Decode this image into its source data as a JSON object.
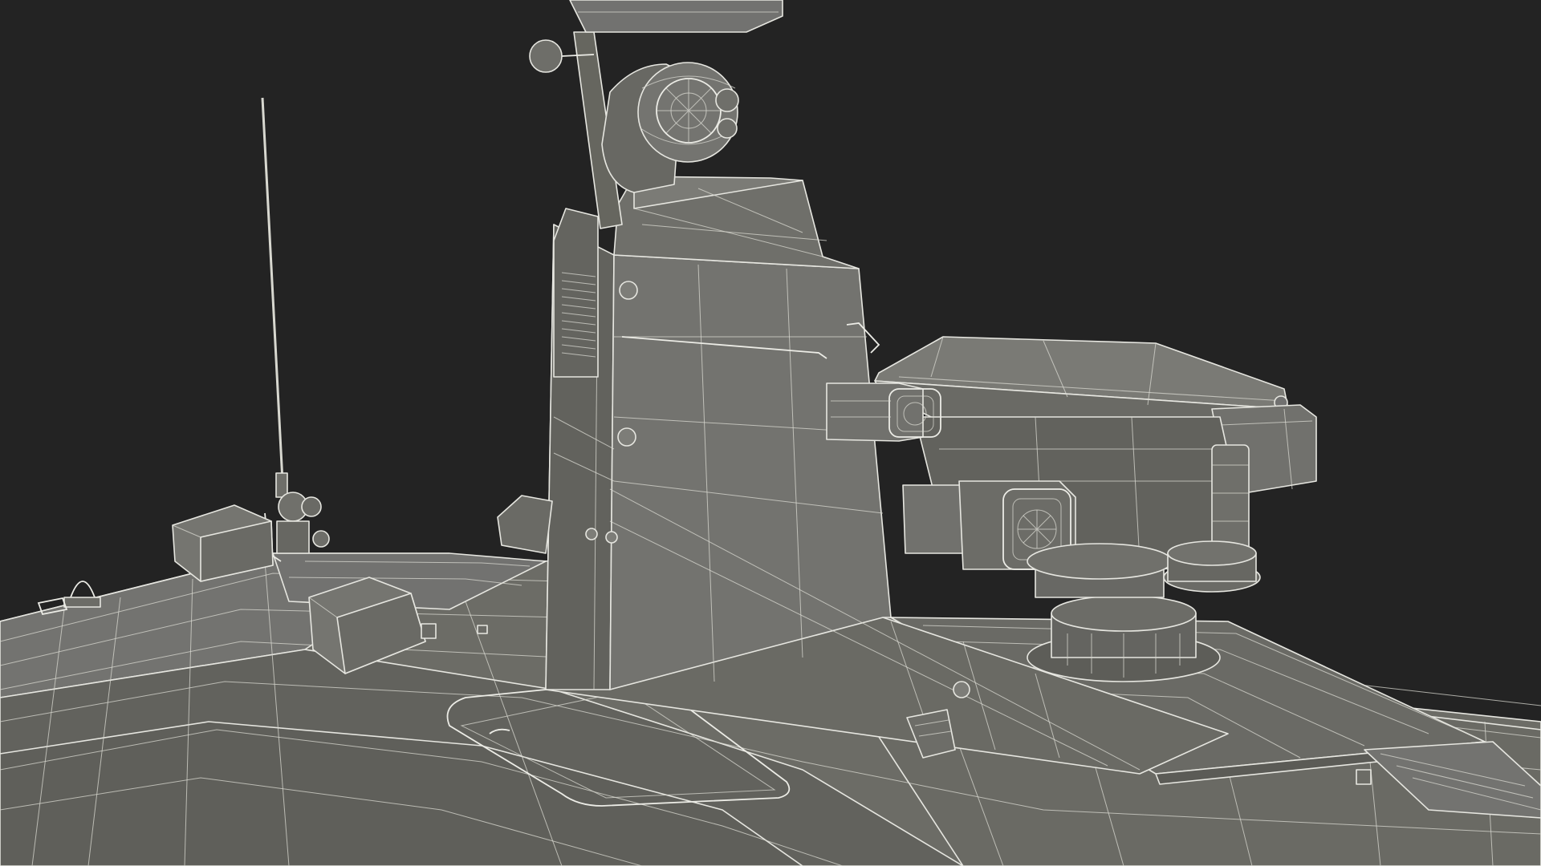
{
  "scene": {
    "background_color": "#232323",
    "model_face_color": "#6e6e68",
    "model_face_dark": "#5a5a55",
    "model_face_light": "#7c7c76",
    "wire_color": "#e6e6e0"
  }
}
